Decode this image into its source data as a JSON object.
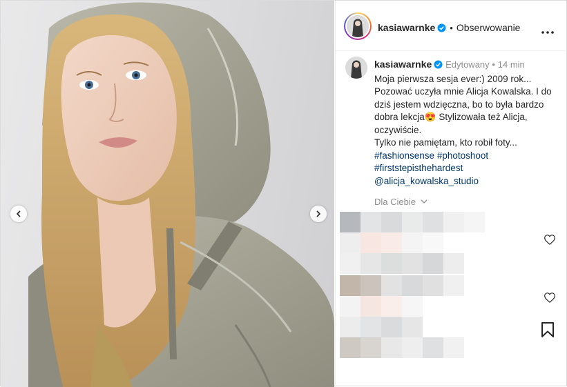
{
  "post": {
    "username": "kasiawarnke",
    "follow_status": "Obserwowanie",
    "separator": "•"
  },
  "caption": {
    "username": "kasiawarnke",
    "edited_label": "Edytowany",
    "separator": "•",
    "time": "14 min",
    "lines": [
      "Moja pierwsza sesja ever:) 2009 rok...",
      "Pozować uczyła mnie Alicja Kowalska. I do",
      "dziś jestem wdzięczna, bo to była bardzo",
      "dobra lekcja😍  Stylizowała też Alicja,",
      "oczywiście.",
      "Tylko nie pamiętam, kto robił foty..."
    ],
    "hashtags": [
      "#fashionsense",
      "#photoshoot",
      "#firststepisthehardest"
    ],
    "mention": "@alicja_kowalska_studio"
  },
  "for_you_label": "Dla Ciebie",
  "icons": {
    "verified": "verified-badge-icon",
    "more": "more-options-icon",
    "prev": "chevron-left-icon",
    "next": "chevron-right-icon",
    "heart": "heart-icon",
    "bookmark": "bookmark-icon"
  },
  "colors": {
    "verified_blue": "#0095f6",
    "hashtag_link": "#00376b",
    "muted_text": "#8e8e8e"
  }
}
